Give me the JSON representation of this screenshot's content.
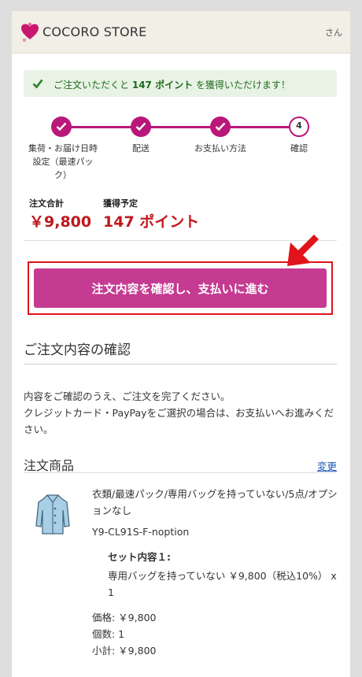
{
  "header": {
    "brand": "COCORO STORE",
    "user_suffix": "さん"
  },
  "notice": {
    "prefix": "ご注文いただくと",
    "points": "147 ポイント",
    "suffix": "を獲得いただけます！"
  },
  "steps": [
    {
      "label": "集荷・お届け日時\n設定（最速パッ\nク）",
      "state": "done"
    },
    {
      "label": "配送",
      "state": "done"
    },
    {
      "label": "お支払い方法",
      "state": "done"
    },
    {
      "label": "確認",
      "state": "current",
      "number": "4"
    }
  ],
  "totals": {
    "order_total_label": "注文合計",
    "order_total": "￥9,800",
    "points_label": "獲得予定",
    "points": "147 ポイント"
  },
  "cta_label": "注文内容を確認し、支払いに進む",
  "section": {
    "title": "ご注文内容の確認",
    "description": "内容をご確認のうえ、ご注文を完了ください。\nクレジットカード・PayPayをご選択の場合は、お支払いへお進みください。"
  },
  "items_section": {
    "title": "注文商品",
    "change_link": "変更"
  },
  "product": {
    "name": "衣類/最速パック/専用バッグを持っていない/5点/オプションなし",
    "sku": "Y9-CL91S-F-noption",
    "set_title": "セット内容１:",
    "set_desc": "専用バッグを持っていない ￥9,800（税込10%） x 1",
    "price": "価格: ￥9,800",
    "quantity": "個数: 1",
    "subtotal": "小計: ￥9,800"
  },
  "colors": {
    "brand": "#b9177a",
    "cta": "#c53b91",
    "price": "#c0171d",
    "link": "#1a58b5",
    "notice_bg": "#e8f3e6"
  }
}
